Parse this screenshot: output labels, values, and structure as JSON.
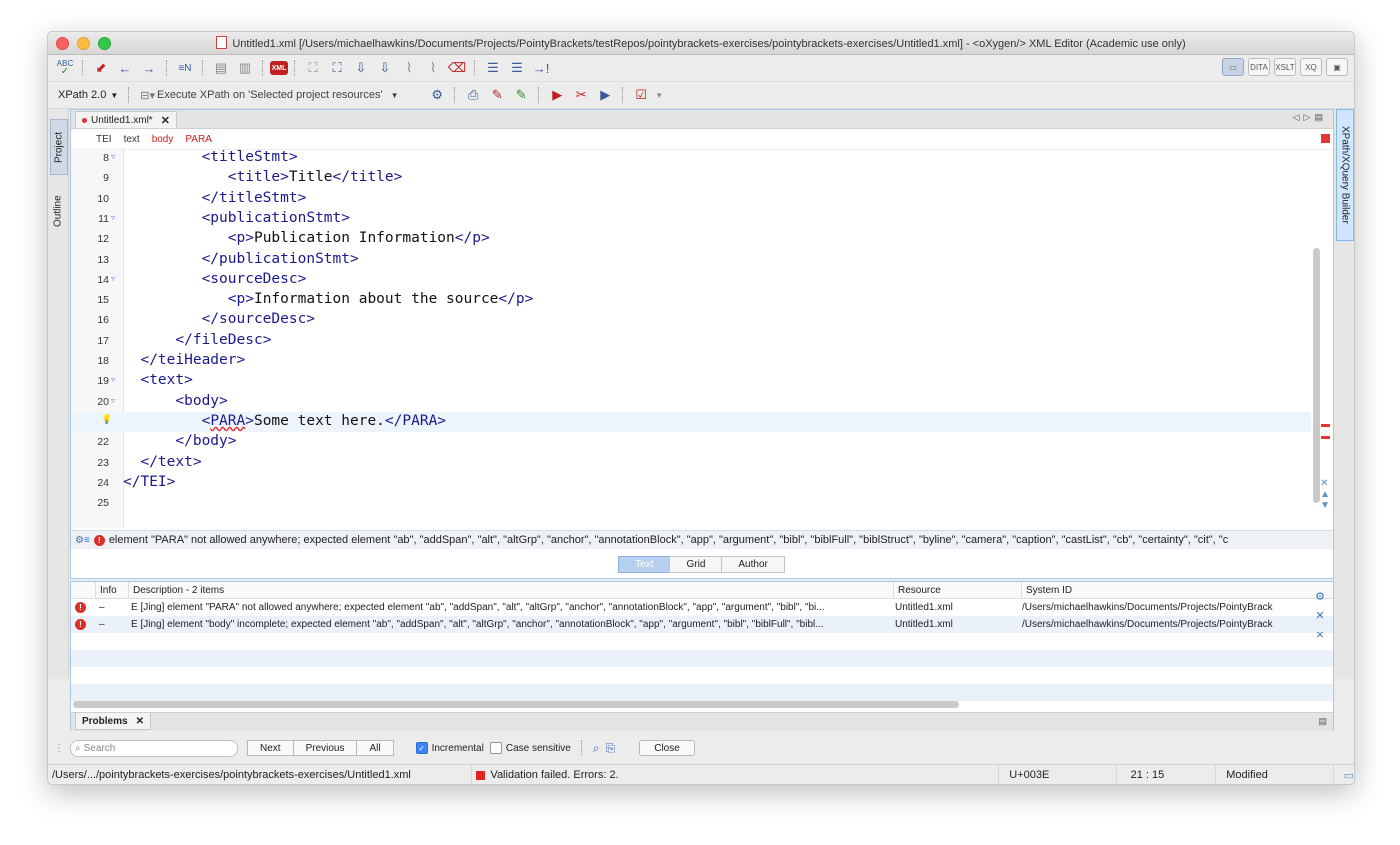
{
  "window": {
    "title": "Untitled1.xml [/Users/michaelhawkins/Documents/Projects/PointyBrackets/testRepos/pointybrackets-exercises/pointybrackets-exercises/Untitled1.xml] - <oXygen/> XML Editor (Academic use only)"
  },
  "toolbar1": {
    "icons": [
      "spellcheck-icon",
      "bookmark-icon",
      "back-arrow-icon",
      "forward-arrow-icon",
      "go-to-line-icon",
      "format-indent-icon",
      "toggle-comment-icon",
      "xml-refactor-icon",
      "select-element-icon",
      "select-content-icon",
      "move-up-icon",
      "move-down-icon",
      "join-icon",
      "split-icon",
      "delete-icon",
      "indent-icon",
      "outdent-icon",
      "next-problem-icon"
    ],
    "abc_label": "ABC",
    "xml_label": "XML",
    "right": [
      "DITA",
      "XSLT",
      "XQ"
    ]
  },
  "toolbar2": {
    "xpath_version": "XPath 2.0",
    "xpath_scope": "Execute XPath on  'Selected project resources'"
  },
  "sidebars": {
    "project": "Project",
    "outline": "Outline",
    "xpath_builder": "XPath/XQuery Builder"
  },
  "editor": {
    "tab_label": "Untitled1.xml*",
    "breadcrumb": [
      {
        "text": "TEI",
        "error": false
      },
      {
        "text": "text",
        "error": false
      },
      {
        "text": "body",
        "error": true
      },
      {
        "text": "PARA",
        "error": true
      }
    ],
    "lines": [
      {
        "num": "8",
        "fold": true,
        "indent": "         ",
        "parts": [
          [
            "tag",
            "<titleStmt>"
          ]
        ]
      },
      {
        "num": "9",
        "fold": false,
        "indent": "            ",
        "parts": [
          [
            "tag",
            "<title>"
          ],
          [
            "text",
            "Title"
          ],
          [
            "tag",
            "</title>"
          ]
        ]
      },
      {
        "num": "10",
        "fold": false,
        "indent": "         ",
        "parts": [
          [
            "tag",
            "</titleStmt>"
          ]
        ]
      },
      {
        "num": "11",
        "fold": true,
        "indent": "         ",
        "parts": [
          [
            "tag",
            "<publicationStmt>"
          ]
        ]
      },
      {
        "num": "12",
        "fold": false,
        "indent": "            ",
        "parts": [
          [
            "tag",
            "<p>"
          ],
          [
            "text",
            "Publication Information"
          ],
          [
            "tag",
            "</p>"
          ]
        ]
      },
      {
        "num": "13",
        "fold": false,
        "indent": "         ",
        "parts": [
          [
            "tag",
            "</publicationStmt>"
          ]
        ]
      },
      {
        "num": "14",
        "fold": true,
        "indent": "         ",
        "parts": [
          [
            "tag",
            "<sourceDesc>"
          ]
        ]
      },
      {
        "num": "15",
        "fold": false,
        "indent": "            ",
        "parts": [
          [
            "tag",
            "<p>"
          ],
          [
            "text",
            "Information about the source"
          ],
          [
            "tag",
            "</p>"
          ]
        ]
      },
      {
        "num": "16",
        "fold": false,
        "indent": "         ",
        "parts": [
          [
            "tag",
            "</sourceDesc>"
          ]
        ]
      },
      {
        "num": "17",
        "fold": false,
        "indent": "      ",
        "parts": [
          [
            "tag",
            "</fileDesc>"
          ]
        ]
      },
      {
        "num": "18",
        "fold": false,
        "indent": "  ",
        "parts": [
          [
            "tag",
            "</teiHeader>"
          ]
        ]
      },
      {
        "num": "19",
        "fold": true,
        "indent": "  ",
        "parts": [
          [
            "tag",
            "<text>"
          ]
        ]
      },
      {
        "num": "20",
        "fold": true,
        "indent": "      ",
        "parts": [
          [
            "tag",
            "<body>"
          ]
        ]
      },
      {
        "num": "",
        "bulb": true,
        "current": true,
        "indent": "         ",
        "parts": [
          [
            "tag",
            "<"
          ],
          [
            "err",
            "PARA"
          ],
          [
            "tag",
            ">"
          ],
          [
            "text",
            "Some text here."
          ],
          [
            "tag",
            "</PARA>"
          ]
        ]
      },
      {
        "num": "22",
        "fold": false,
        "indent": "      ",
        "parts": [
          [
            "tag",
            "</body>"
          ]
        ]
      },
      {
        "num": "23",
        "fold": false,
        "indent": "  ",
        "parts": [
          [
            "tag",
            "</text>"
          ]
        ]
      },
      {
        "num": "24",
        "fold": false,
        "indent": "",
        "parts": [
          [
            "tag",
            "</TEI>"
          ]
        ]
      },
      {
        "num": "25",
        "fold": false,
        "indent": "",
        "parts": []
      }
    ],
    "error_message": "element \"PARA\" not allowed anywhere; expected element \"ab\", \"addSpan\", \"alt\", \"altGrp\", \"anchor\", \"annotationBlock\", \"app\", \"argument\", \"bibl\", \"biblFull\", \"biblStruct\", \"byline\", \"camera\", \"caption\", \"castList\", \"cb\", \"certainty\", \"cit\", \"c",
    "modes": [
      "Text",
      "Grid",
      "Author"
    ],
    "active_mode": "Text"
  },
  "problems": {
    "columns": [
      "Info",
      "Description - 2 items",
      "Resource",
      "System ID"
    ],
    "rows": [
      {
        "info": "–",
        "desc": "E [Jing] element \"PARA\" not allowed anywhere; expected element \"ab\", \"addSpan\", \"alt\", \"altGrp\", \"anchor\", \"annotationBlock\", \"app\", \"argument\", \"bibl\", \"bi...",
        "resource": "Untitled1.xml",
        "system_id": "/Users/michaelhawkins/Documents/Projects/PointyBrack"
      },
      {
        "info": "–",
        "desc": "E [Jing] element \"body\" incomplete; expected element \"ab\", \"addSpan\", \"alt\", \"altGrp\", \"anchor\", \"annotationBlock\", \"app\", \"argument\", \"bibl\", \"biblFull\", \"bibl...",
        "resource": "Untitled1.xml",
        "system_id": "/Users/michaelhawkins/Documents/Projects/PointyBrack"
      }
    ],
    "tab_label": "Problems"
  },
  "find": {
    "placeholder": "Search",
    "next": "Next",
    "previous": "Previous",
    "all": "All",
    "incremental": "Incremental",
    "case_sensitive": "Case sensitive",
    "close": "Close"
  },
  "status": {
    "path": "/Users/.../pointybrackets-exercises/pointybrackets-exercises/Untitled1.xml",
    "validation": "Validation failed. Errors: 2.",
    "unicode": "U+003E",
    "position": "21 : 15",
    "state": "Modified"
  },
  "colors": {
    "tag": "#1a1a8c",
    "error": "#d01e1e",
    "accent": "#a9c7ea"
  }
}
